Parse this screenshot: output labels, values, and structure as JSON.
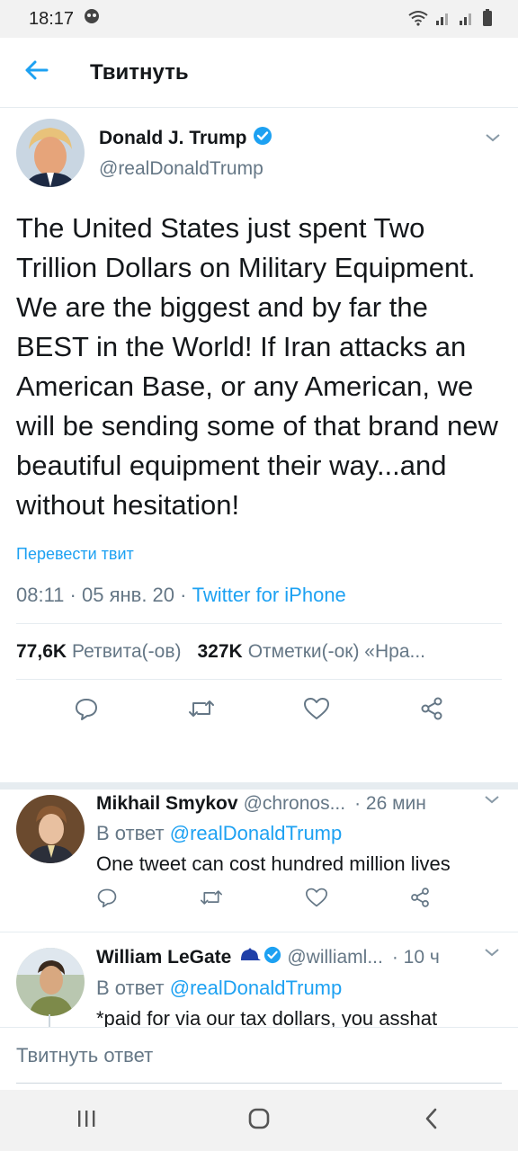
{
  "status_bar": {
    "time": "18:17"
  },
  "header": {
    "title": "Твитнуть"
  },
  "tweet": {
    "author_name": "Donald J. Trump",
    "author_handle": "@realDonaldTrump",
    "text": "The United States just spent Two Trillion Dollars on Military Equipment. We are the biggest and by far the BEST in the World! If Iran attacks an American Base, or any American, we will be sending some of that brand new beautiful equipment their way...and without hesitation!",
    "translate_label": "Перевести твит",
    "time": "08:11",
    "date": "05 янв. 20",
    "source": "Twitter for iPhone",
    "retweets_count": "77,6K",
    "retweets_label": "Ретвита(-ов)",
    "likes_count": "327K",
    "likes_label": "Отметки(-ок) «Нра..."
  },
  "replies": [
    {
      "name": "Mikhail Smykov",
      "handle": "@chronos...",
      "time": "· 26 мин",
      "reply_to_prefix": "В ответ",
      "reply_to": "@realDonaldTrump",
      "text": "One tweet can cost hundred million lives"
    },
    {
      "name": "William LeGate",
      "handle": "@williaml...",
      "time": "· 10 ч",
      "reply_to_prefix": "В ответ",
      "reply_to": "@realDonaldTrump",
      "text": "*paid for via our tax dollars, you asshat"
    }
  ],
  "compose": {
    "placeholder": "Твитнуть ответ"
  },
  "colors": {
    "accent": "#1da1f2",
    "muted": "#657786",
    "text": "#14171a",
    "border": "#e6ecf0"
  },
  "icons": [
    "back-arrow-icon",
    "verified-icon",
    "chevron-down-icon",
    "reply-icon",
    "retweet-icon",
    "like-icon",
    "share-icon",
    "cap-emoji-icon"
  ]
}
